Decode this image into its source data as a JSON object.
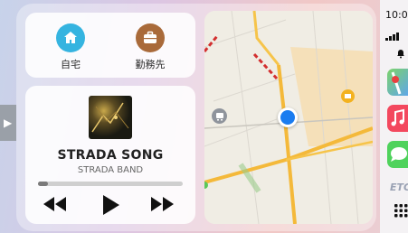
{
  "shortcuts": [
    {
      "label": "自宅",
      "icon": "home-icon"
    },
    {
      "label": "勤務先",
      "icon": "briefcase-icon"
    }
  ],
  "player": {
    "song_title": "STRADA SONG",
    "artist": "STRADA BAND",
    "progress": 0.07
  },
  "status": {
    "time": "10:0"
  },
  "dock": {
    "etc_label": "ETC"
  },
  "colors": {
    "accent_blue": "#1a7cf0",
    "home_icon_bg": "#35b4e0",
    "work_icon_bg": "#a96a3a"
  }
}
